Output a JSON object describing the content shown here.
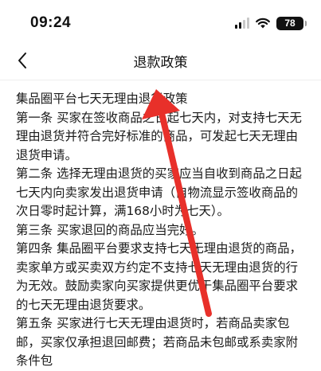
{
  "status_bar": {
    "time": "09:24",
    "battery": "78"
  },
  "nav": {
    "back_icon": "chevron-left-icon",
    "title": "退款政策"
  },
  "policy": {
    "heading": "集品圈平台七天无理由退货政策",
    "paragraphs": [
      "第一条 买家在签收商品之日起七天内，对支持七天无理由退货并符合完好标准的商品，可发起七天无理由退货申请。",
      "第二条 选择无理由退货的买家应当自收到商品之日起七天内向卖家发出退货申请（自物流显示签收商品的次日零时起计算，满168小时为七天）。",
      "第三条 买家退回的商品应当完好。",
      "第四条 集品圈平台要求支持七天无理由退货的商品，卖家单方或买卖双方约定不支持七天无理由退货的行为无效。鼓励卖家向买家提供更优于集品圈平台要求的七天无理由退货要求。",
      "第五条 买家进行七天无理由退货时，若商品卖家包邮，买家仅承担退回邮费；若商品未包邮或系卖家附条件包"
    ]
  },
  "annotation": {
    "arrow_color": "#e8302a"
  }
}
